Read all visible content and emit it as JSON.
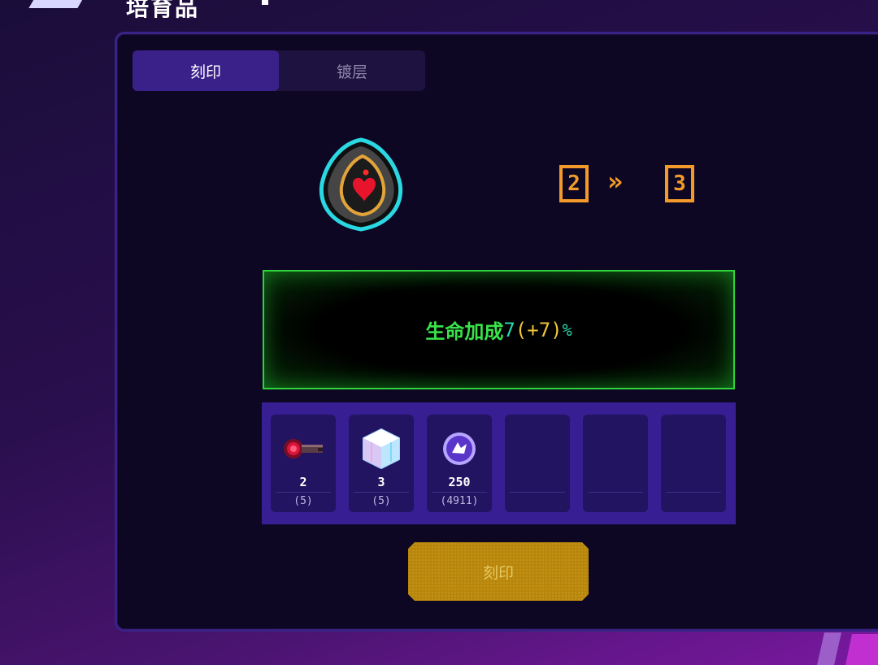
{
  "header": {
    "title": "培育品"
  },
  "tabs": [
    {
      "label": "刻印",
      "active": true
    },
    {
      "label": "镀层",
      "active": false
    }
  ],
  "relic": {
    "icon": "heart-relic-icon"
  },
  "level": {
    "from": "2",
    "to": "3",
    "arrow": "»"
  },
  "effect": {
    "name": "生命加成",
    "value": "7",
    "bonus": "(+7)",
    "unit": "%"
  },
  "materials": [
    {
      "icon": "red-key-icon",
      "count": "2",
      "need": "(5)"
    },
    {
      "icon": "crystal-cube-icon",
      "count": "3",
      "need": "(5)"
    },
    {
      "icon": "purple-coin-icon",
      "count": "250",
      "need": "(4911)"
    },
    {
      "icon": "",
      "count": "",
      "need": ""
    },
    {
      "icon": "",
      "count": "",
      "need": ""
    },
    {
      "icon": "",
      "count": "",
      "need": ""
    }
  ],
  "action": {
    "label": "刻印"
  },
  "colors": {
    "accent": "#f39a2a",
    "effect_green": "#39e34a",
    "button": "#b8860b"
  }
}
